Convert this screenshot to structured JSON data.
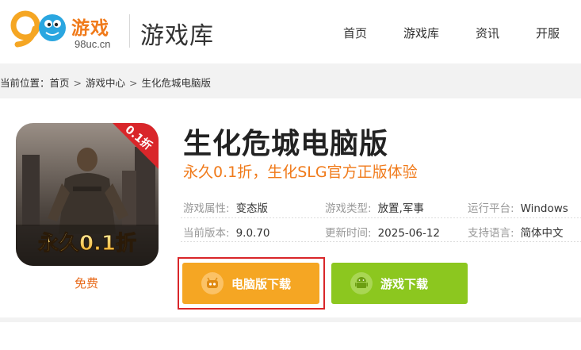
{
  "header": {
    "logo_text": "游戏",
    "logo_sub": "98uc.cn",
    "title": "游戏库",
    "nav": [
      "首页",
      "游戏库",
      "资讯",
      "开服"
    ]
  },
  "breadcrumb": {
    "prefix": "当前位置：",
    "items": [
      "首页",
      "游戏中心",
      "生化危城电脑版"
    ],
    "separator": ">"
  },
  "game": {
    "cover_badge": "0.1折",
    "cover_caption": "永久0.1折",
    "price_label": "免费",
    "title": "生化危城电脑版",
    "slogan": "永久0.1折，生化SLG官方正版体验",
    "meta": [
      {
        "key": "游戏属性:",
        "value": "变态版"
      },
      {
        "key": "游戏类型:",
        "value": "放置,军事"
      },
      {
        "key": "运行平台:",
        "value": "Windows"
      },
      {
        "key": "当前版本:",
        "value": "9.0.70"
      },
      {
        "key": "更新时间:",
        "value": "2025-06-12"
      },
      {
        "key": "支持语言:",
        "value": "简体中文"
      }
    ]
  },
  "buttons": {
    "pc_download": "电脑版下载",
    "game_download": "游戏下载"
  },
  "icons": {
    "pc_button_icon": "robot-icon",
    "game_button_icon": "android-icon"
  },
  "colors": {
    "brand_orange": "#f07a1a",
    "pc_button": "#f5a623",
    "game_button": "#8cc71f",
    "highlight": "#d9262a"
  }
}
